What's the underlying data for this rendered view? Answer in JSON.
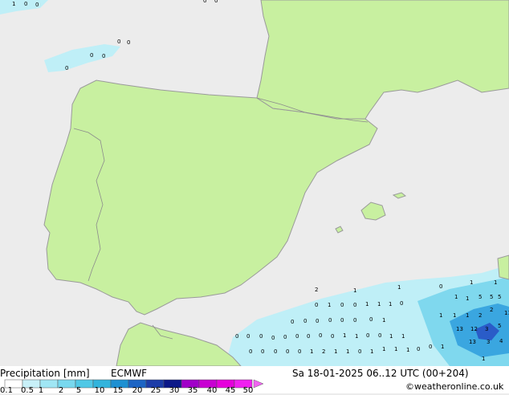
{
  "header": {
    "title": "Precipitation [mm]",
    "model": "ECMWF",
    "datetime": "Sa 18-01-2025 06..12 UTC (00+204)",
    "credit": "©weatheronline.co.uk"
  },
  "legend": {
    "ticks": [
      "0.1",
      "0.5",
      "1",
      "2",
      "5",
      "10",
      "15",
      "20",
      "25",
      "30",
      "35",
      "40",
      "45",
      "50"
    ],
    "colors": [
      "#ffffff",
      "#c8f0f8",
      "#a0e6f4",
      "#78d8ee",
      "#50c8e6",
      "#32b4dc",
      "#1e90d2",
      "#1c64c4",
      "#1c3ca8",
      "#0c1888",
      "#a000c8",
      "#c800d2",
      "#e600dc",
      "#f020f0",
      "#f064f0"
    ]
  },
  "map_values": {
    "north_sea": [
      "1",
      "0",
      "0",
      "0",
      "0",
      "0",
      "0",
      "0",
      "0",
      "0"
    ],
    "south_sea": [
      "0",
      "0",
      "0",
      "0",
      "0",
      "0",
      "0",
      "0",
      "0",
      "1",
      "1",
      "0",
      "0",
      "1",
      "1",
      "0",
      "0",
      "0",
      "0",
      "0",
      "1",
      "2",
      "1",
      "1",
      "0",
      "1",
      "1",
      "1",
      "1",
      "0",
      "0",
      "1",
      "0",
      "1",
      "0",
      "0",
      "1",
      "1",
      "1",
      "0",
      "0",
      "0",
      "0",
      "0",
      "0",
      "0",
      "0",
      "1",
      "2",
      "1",
      "1",
      "0",
      "1",
      "1",
      "1",
      "1",
      "5",
      "5",
      "5",
      "1",
      "1",
      "1",
      "2",
      "2",
      "11",
      "13",
      "12",
      "3",
      "5",
      "13",
      "3",
      "4",
      "1"
    ]
  },
  "colors": {
    "sea": "#ececec",
    "land": "#c8f0a0",
    "border": "#8c8c8c",
    "coast": "#9a9a9a"
  }
}
